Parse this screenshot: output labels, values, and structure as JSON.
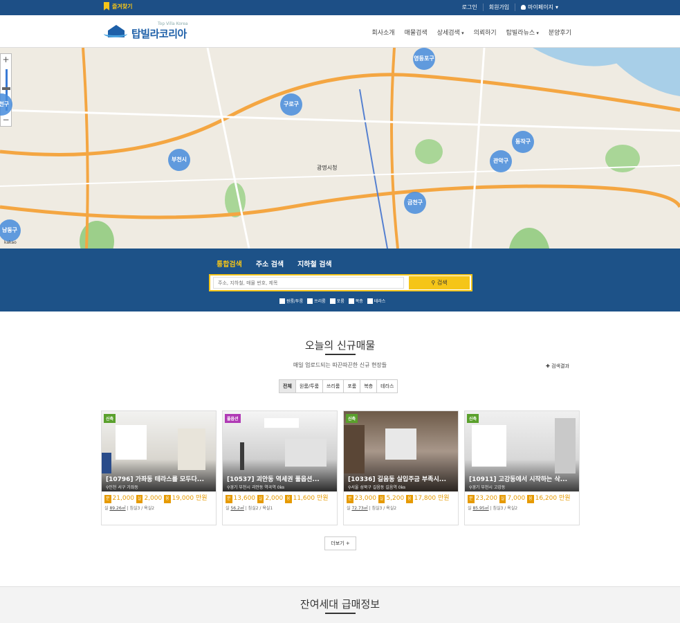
{
  "topbar": {
    "favorite": "즐겨찾기",
    "login": "로그인",
    "signup": "회원가입",
    "mypage": "마이페이지"
  },
  "header": {
    "logo_sub": "Top Villa Korea",
    "logo_main": "탑빌라코리아",
    "nav": [
      "회사소개",
      "매물검색",
      "상세검색",
      "의뢰하기",
      "탑빌라뉴스",
      "분양후기"
    ]
  },
  "map": {
    "clusters": [
      "영등포구",
      "동작구",
      "구로구",
      "관악구",
      "부천시",
      "금천구",
      "남동구",
      "양천구"
    ],
    "attribution": "kakao",
    "district_label": "광명시청"
  },
  "search": {
    "tabs": [
      "통합검색",
      "주소 검색",
      "지하철 검색"
    ],
    "placeholder": "주소, 지하철, 매물 번호, 제목",
    "button": "검색",
    "checks": [
      "원룸/투룸",
      "쓰리룸",
      "포룸",
      "복층",
      "테라스"
    ]
  },
  "listing": {
    "title": "오늘의 신규매물",
    "subtitle": "매일 업로드되는 따끈따끈한 신규 현장들",
    "more_link": "검색결과",
    "filters": [
      "전체",
      "원룸/투룸",
      "쓰리룸",
      "포룸",
      "복층",
      "테라스"
    ],
    "cards": [
      {
        "badge": "신축",
        "badge_color": "#5aa02c",
        "title": "[10796] 가좌동 테라스를 모두다...",
        "loc": "인천 서구 가좌동",
        "p1": "21,000",
        "p2": "2,000",
        "p3": "19,000",
        "area": "89.26㎡",
        "rooms": "침실3 / 욕실2"
      },
      {
        "badge": "풀옵션",
        "badge_color": "#b03ab5",
        "title": "[10537] 괴안동 역세권 풀옵션...",
        "loc": "경기 부천시 괴안동  역곡역 0㎞",
        "p1": "13,600",
        "p2": "2,000",
        "p3": "11,600",
        "area": "56.2㎡",
        "rooms": "침실2 / 욕실1"
      },
      {
        "badge": "신축",
        "badge_color": "#5aa02c",
        "title": "[10336] 길음동 실입주금 부족시...",
        "loc": "서울 성북구 길음동  길음역 0㎞",
        "p1": "23,000",
        "p2": "5,200",
        "p3": "17,800",
        "area": "72.73㎡",
        "rooms": "침실3 / 욕실2"
      },
      {
        "badge": "신축",
        "badge_color": "#5aa02c",
        "title": "[10911] 고강동에서 시작하는 삭...",
        "loc": "경기 부천시 고강동",
        "p1": "23,200",
        "p2": "7,000",
        "p3": "16,200",
        "area": "85.95㎡",
        "rooms": "침실3 / 욕실2"
      }
    ],
    "price_labels": [
      "분",
      "실",
      "융"
    ],
    "unit": "만원",
    "area_prefix": "실",
    "more_button": "더보기 +"
  },
  "section2": {
    "title": "잔여세대 급매정보"
  }
}
